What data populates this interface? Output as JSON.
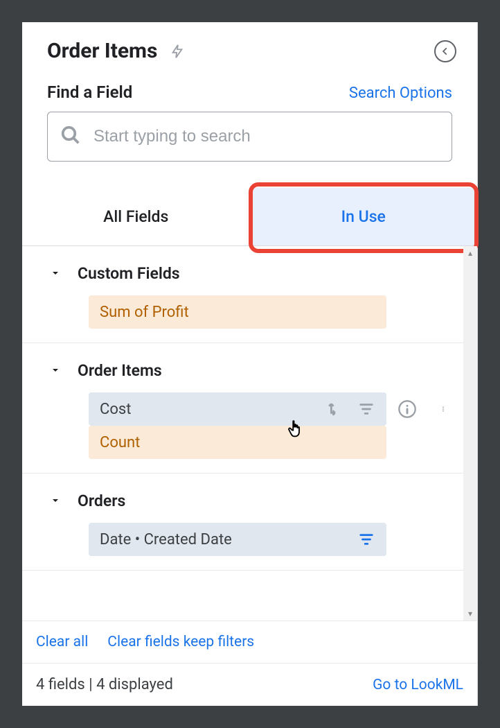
{
  "header": {
    "title": "Order Items"
  },
  "search": {
    "find_label": "Find a Field",
    "options_label": "Search Options",
    "placeholder": "Start typing to search"
  },
  "tabs": {
    "all_fields": "All Fields",
    "in_use": "In Use"
  },
  "groups": [
    {
      "title": "Custom Fields",
      "fields": [
        {
          "label": "Sum of Profit",
          "style": "orange"
        }
      ]
    },
    {
      "title": "Order Items",
      "fields": [
        {
          "label": "Cost",
          "style": "blue",
          "hovered": true
        },
        {
          "label": "Count",
          "style": "orange"
        }
      ]
    },
    {
      "title": "Orders",
      "fields": [
        {
          "label": "Date • Created Date",
          "style": "blue",
          "filtered": true
        }
      ]
    }
  ],
  "footer": {
    "clear_all": "Clear all",
    "clear_keep": "Clear fields keep filters",
    "status": "4 fields | 4 displayed",
    "lookml": "Go to LookML"
  }
}
